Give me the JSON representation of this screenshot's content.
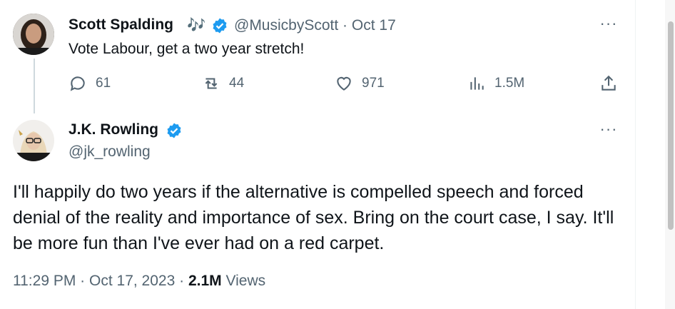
{
  "reply": {
    "name": "Scott Spalding",
    "emoji": "🎶",
    "handle": "@MusicbyScott",
    "separator": "·",
    "date": "Oct 17",
    "text": "Vote Labour, get a two year stretch!",
    "actions": {
      "replies": "61",
      "retweets": "44",
      "likes": "971",
      "views": "1.5M"
    }
  },
  "main": {
    "name": "J.K. Rowling",
    "handle": "@jk_rowling",
    "text": "I'll happily do two years if the alternative is compelled speech and forced denial of the reality and importance of sex. Bring on the court case, I say. It'll be more fun than I've ever had on a red carpet.",
    "time": "11:29 PM",
    "date": "Oct 17, 2023",
    "views_count": "2.1M",
    "views_label": "Views",
    "separator": "·"
  },
  "more_label": "···",
  "colors": {
    "verified": "#1d9bf0",
    "muted": "#536471",
    "text": "#0f1419"
  }
}
